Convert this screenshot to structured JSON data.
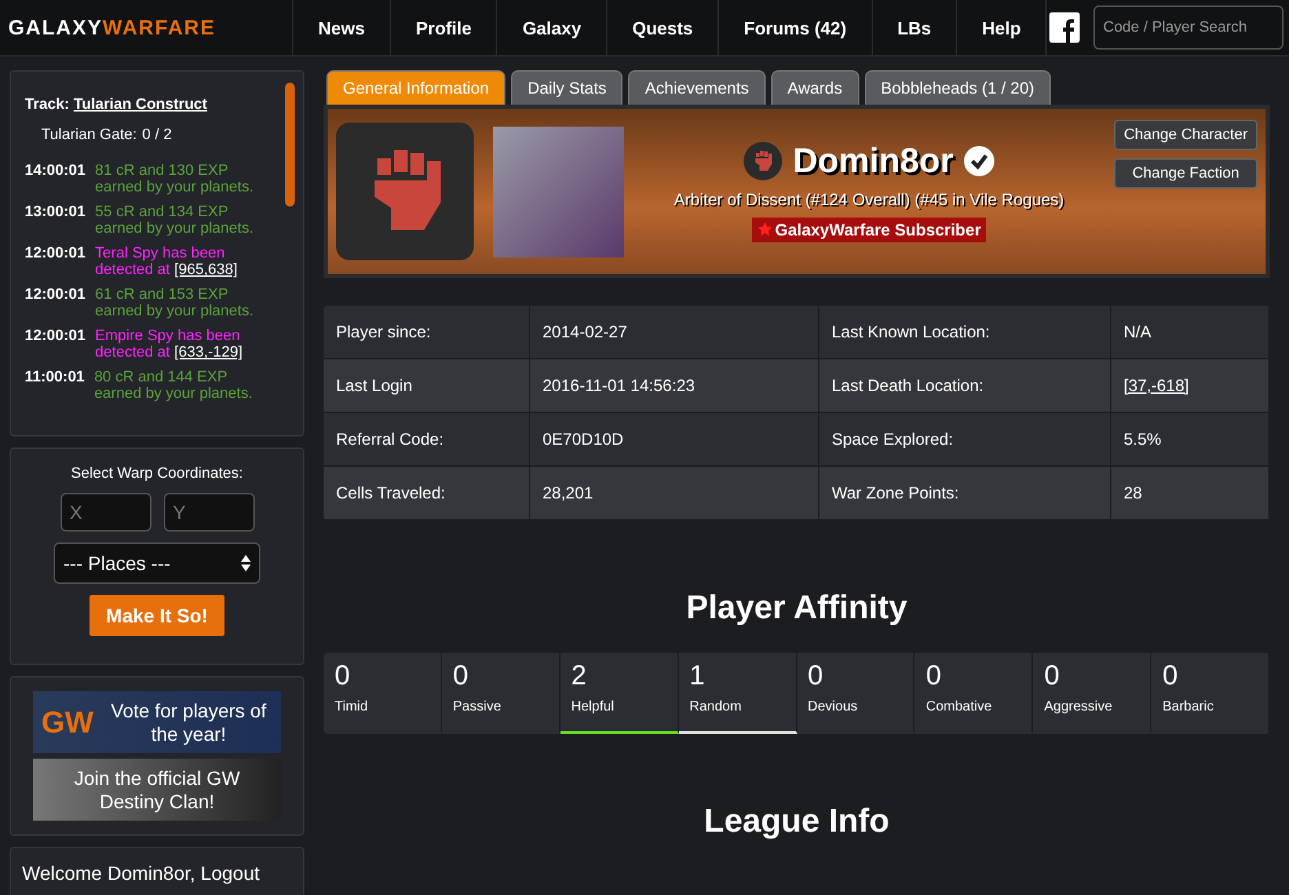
{
  "brand": {
    "first": "GALAXY",
    "second": "WARFARE"
  },
  "nav": [
    {
      "label": "News"
    },
    {
      "label": "Profile"
    },
    {
      "label": "Galaxy"
    },
    {
      "label": "Quests"
    },
    {
      "label": "Forums (42)"
    },
    {
      "label": "LBs"
    },
    {
      "label": "Help"
    }
  ],
  "search": {
    "placeholder": "Code / Player Search"
  },
  "tracker": {
    "label": "Track:",
    "target": "Tularian Construct",
    "goal": "Tularian Gate:",
    "count": "0 / 2"
  },
  "log": [
    {
      "time": "14:00:01",
      "kind": "income",
      "text": "81 cR and 130 EXP earned by your planets."
    },
    {
      "time": "13:00:01",
      "kind": "income",
      "text": "55 cR and 134 EXP earned by your planets."
    },
    {
      "time": "12:00:01",
      "kind": "spy",
      "text": "Teral Spy has been detected at",
      "link": "[965,638]"
    },
    {
      "time": "12:00:01",
      "kind": "income",
      "text": "61 cR and 153 EXP earned by your planets."
    },
    {
      "time": "12:00:01",
      "kind": "spy",
      "text": "Empire Spy has been detected at",
      "link": "[633,-129]"
    },
    {
      "time": "11:00:01",
      "kind": "income",
      "text": "80 cR and 144 EXP earned by your planets."
    }
  ],
  "warp": {
    "title": "Select Warp Coordinates:",
    "x_placeholder": "X",
    "y_placeholder": "Y",
    "places": "--- Places ---",
    "button": "Make It So!"
  },
  "banners": [
    {
      "logo": "GW",
      "text": "Vote for players of the year!"
    },
    {
      "text": "Join the official GW Destiny Clan!"
    }
  ],
  "welcome": "Welcome Domin8or, Logout",
  "tabs": [
    {
      "label": "General Information",
      "selected": true
    },
    {
      "label": "Daily Stats",
      "selected": false
    },
    {
      "label": "Achievements",
      "selected": false
    },
    {
      "label": "Awards",
      "selected": false
    },
    {
      "label": "Bobbleheads (1 / 20)",
      "selected": false
    }
  ],
  "profile": {
    "name": "Domin8or",
    "verified": true,
    "rank": "Arbiter of Dissent (#124 Overall) (#45 in Vile Rogues)",
    "subscriber": "GalaxyWarfare Subscriber",
    "buttons": [
      "Change Character",
      "Change Faction"
    ]
  },
  "stats": [
    [
      {
        "label": "Player since:",
        "value": "2014-02-27"
      },
      {
        "label": "Last Known Location:",
        "value": "N/A"
      }
    ],
    [
      {
        "label": "Last Login",
        "value": "2016-11-01 14:56:23"
      },
      {
        "label": "Last Death Location:",
        "value": "[37,-618]",
        "link": true
      }
    ],
    [
      {
        "label": "Referral Code:",
        "value": "0E70D10D"
      },
      {
        "label": "Space Explored:",
        "value": "5.5%"
      }
    ],
    [
      {
        "label": "Cells Traveled:",
        "value": "28,201"
      },
      {
        "label": "War Zone Points:",
        "value": "28"
      }
    ]
  ],
  "affinity_title": "Player Affinity",
  "affinity": [
    {
      "count": "0",
      "name": "Timid"
    },
    {
      "count": "0",
      "name": "Passive"
    },
    {
      "count": "2",
      "name": "Helpful",
      "color": "#66dd22"
    },
    {
      "count": "1",
      "name": "Random",
      "color": "#e0e0e0"
    },
    {
      "count": "0",
      "name": "Devious"
    },
    {
      "count": "0",
      "name": "Combative"
    },
    {
      "count": "0",
      "name": "Aggressive"
    },
    {
      "count": "0",
      "name": "Barbaric"
    }
  ],
  "league_title": "League Info"
}
